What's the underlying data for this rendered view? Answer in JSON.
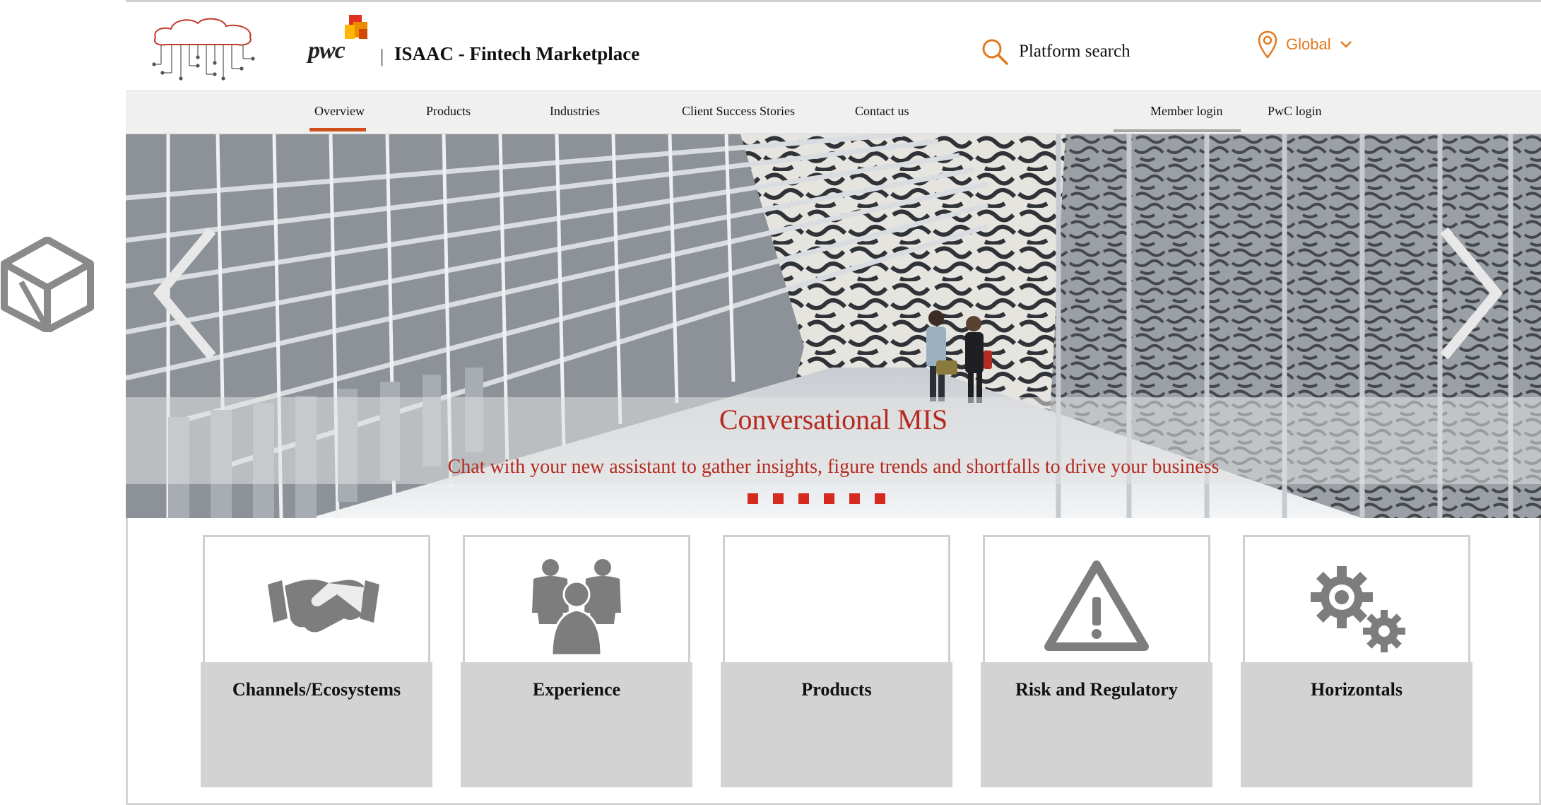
{
  "header": {
    "brand": "pwc",
    "separator": "|",
    "title": "ISAAC - Fintech Marketplace",
    "search_label": "Platform search",
    "region_label": "Global"
  },
  "nav": {
    "items": [
      "Overview",
      "Products",
      "Industries",
      "Client Success Stories",
      "Contact us"
    ],
    "right_items": [
      "Member login",
      "PwC login"
    ],
    "active": "Overview"
  },
  "hero": {
    "title": "Conversational MIS",
    "subtitle": "Chat with your new assistant to gather insights, figure trends and shortfalls to drive your business",
    "slide_count": 6
  },
  "cards": [
    {
      "label": "Channels/Ecosystems",
      "icon": "handshake-icon"
    },
    {
      "label": "Experience",
      "icon": "people-group-icon"
    },
    {
      "label": "Products",
      "icon": ""
    },
    {
      "label": "Risk and Regulatory",
      "icon": "warning-triangle-icon"
    },
    {
      "label": "Horizontals",
      "icon": "gears-icon"
    }
  ],
  "colors": {
    "accent_orange": "#e07a1f",
    "caption_red": "#b52a1f",
    "dot_red": "#d42b1e",
    "card_gray": "#d3d3d3",
    "icon_gray": "#7d7d7d"
  }
}
